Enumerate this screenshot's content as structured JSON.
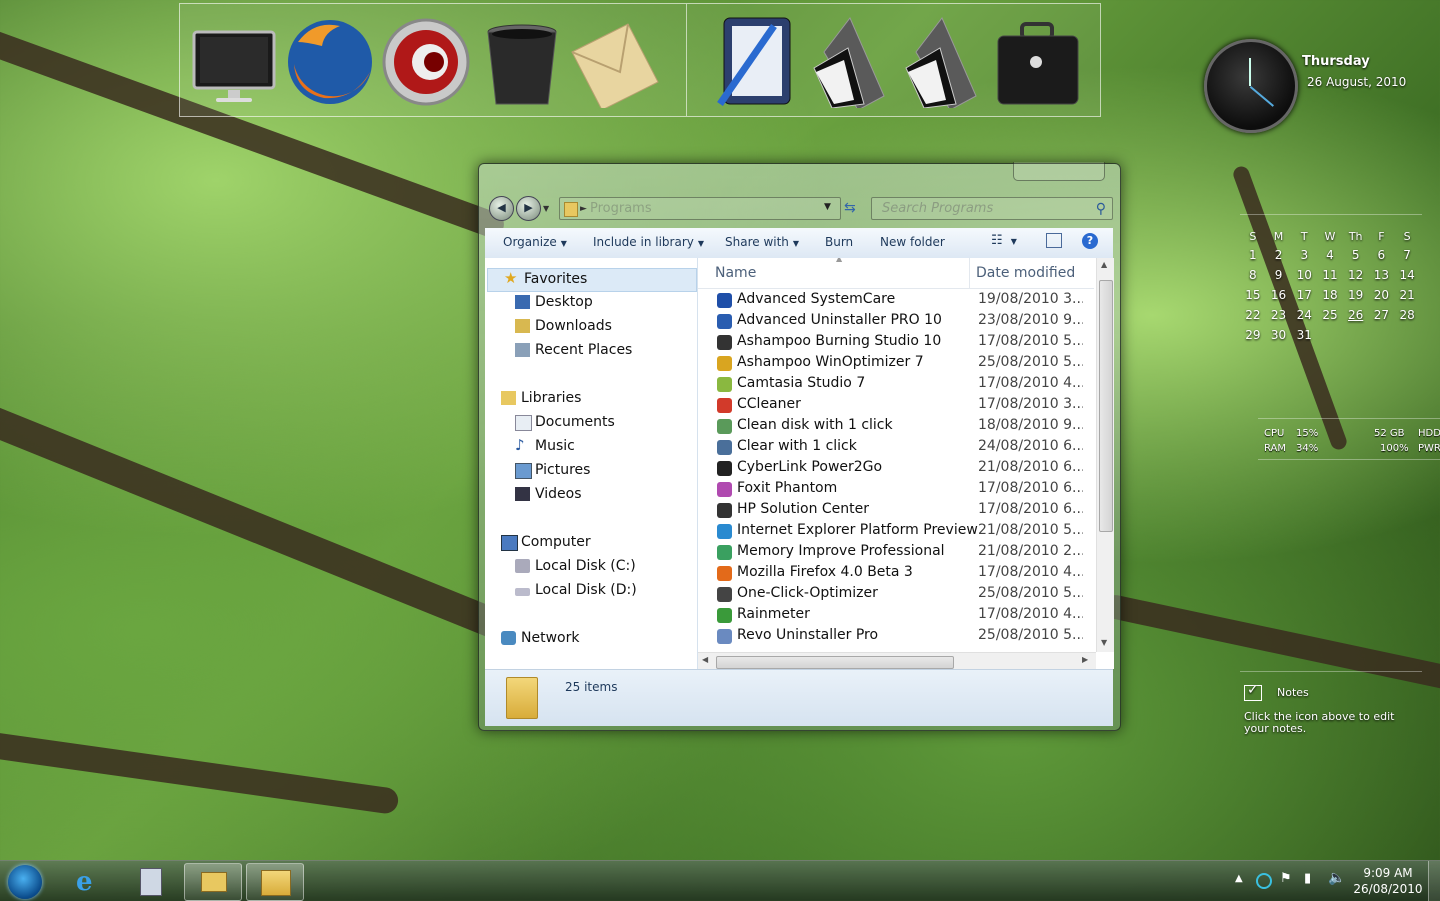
{
  "dock": {
    "items": [
      {
        "name": "computer-monitor"
      },
      {
        "name": "firefox"
      },
      {
        "name": "comodo-dragon"
      },
      {
        "name": "recycle-bin"
      },
      {
        "name": "mail-envelope"
      },
      {
        "name": "notepad-editor"
      },
      {
        "name": "folder-dark-1"
      },
      {
        "name": "folder-dark-2"
      },
      {
        "name": "briefcase"
      }
    ]
  },
  "clock_gadget": {
    "day": "Thursday",
    "date": "26 August, 2010"
  },
  "calendar": {
    "weekdays": [
      "S",
      "M",
      "T",
      "W",
      "Th",
      "F",
      "S"
    ],
    "weeks": [
      [
        "",
        "1",
        "2",
        "3",
        "4",
        "5",
        "6",
        "7"
      ],
      [
        "8",
        "9",
        "10",
        "11",
        "12",
        "13",
        "14"
      ],
      [
        "15",
        "16",
        "17",
        "18",
        "19",
        "20",
        "21"
      ],
      [
        "22",
        "23",
        "24",
        "25",
        "26",
        "27",
        "28"
      ],
      [
        "29",
        "30",
        "31",
        "",
        "",
        "",
        ""
      ]
    ],
    "today": "26"
  },
  "system_meter": {
    "cpu_label": "CPU",
    "cpu_value": "15%",
    "ram_label": "RAM",
    "ram_value": "34%",
    "hdd_value": "52 GB",
    "pwr_value": "100%",
    "hdd_label": "HDD",
    "pwr_label": "PWR"
  },
  "notes_gadget": {
    "title": "Notes",
    "hint": "Click the icon above to edit your notes."
  },
  "explorer": {
    "address": "Programs",
    "search_placeholder": "Search Programs",
    "toolbar": {
      "organize": "Organize",
      "include_in_library": "Include in library",
      "share_with": "Share with",
      "burn": "Burn",
      "new_folder": "New folder"
    },
    "nav": {
      "favorites": "Favorites",
      "desktop": "Desktop",
      "downloads": "Downloads",
      "recent_places": "Recent Places",
      "libraries": "Libraries",
      "documents": "Documents",
      "music": "Music",
      "pictures": "Pictures",
      "videos": "Videos",
      "computer": "Computer",
      "local_disk_c": "Local Disk (C:)",
      "local_disk_d": "Local Disk (D:)",
      "network": "Network"
    },
    "columns": {
      "name": "Name",
      "date_modified": "Date modified"
    },
    "files": [
      {
        "name": "Advanced SystemCare",
        "date": "19/08/2010 3...",
        "icon_color": "#1f4fa8"
      },
      {
        "name": "Advanced Uninstaller PRO 10",
        "date": "23/08/2010 9...",
        "icon_color": "#2a5db0"
      },
      {
        "name": "Ashampoo Burning Studio 10",
        "date": "17/08/2010 5...",
        "icon_color": "#333333"
      },
      {
        "name": "Ashampoo WinOptimizer 7",
        "date": "25/08/2010 5...",
        "icon_color": "#d9a520"
      },
      {
        "name": "Camtasia Studio 7",
        "date": "17/08/2010 4...",
        "icon_color": "#8ab840"
      },
      {
        "name": "CCleaner",
        "date": "17/08/2010 3...",
        "icon_color": "#d23a2a"
      },
      {
        "name": "Clean disk with 1 click",
        "date": "18/08/2010 9...",
        "icon_color": "#5a9a5a"
      },
      {
        "name": "Clear with 1 click",
        "date": "24/08/2010 6...",
        "icon_color": "#4a6f9a"
      },
      {
        "name": "CyberLink Power2Go",
        "date": "21/08/2010 6...",
        "icon_color": "#222222"
      },
      {
        "name": "Foxit Phantom",
        "date": "17/08/2010 6...",
        "icon_color": "#b04ab0"
      },
      {
        "name": "HP Solution Center",
        "date": "17/08/2010 6...",
        "icon_color": "#333333"
      },
      {
        "name": "Internet Explorer Platform Preview",
        "date": "21/08/2010 5...",
        "icon_color": "#2a8ad0"
      },
      {
        "name": "Memory Improve Professional",
        "date": "21/08/2010 2...",
        "icon_color": "#3aa060"
      },
      {
        "name": "Mozilla Firefox 4.0 Beta 3",
        "date": "17/08/2010 4...",
        "icon_color": "#e36a1a"
      },
      {
        "name": "One-Click-Optimizer",
        "date": "25/08/2010 5...",
        "icon_color": "#444444"
      },
      {
        "name": "Rainmeter",
        "date": "17/08/2010 4...",
        "icon_color": "#3a9a3a"
      },
      {
        "name": "Revo Uninstaller Pro",
        "date": "25/08/2010 5...",
        "icon_color": "#6a8ac0"
      }
    ],
    "status": "25 items"
  },
  "taskbar": {
    "items": [
      {
        "name": "start-orb"
      },
      {
        "name": "internet-explorer"
      },
      {
        "name": "calculator"
      },
      {
        "name": "window-switcher"
      },
      {
        "name": "windows-explorer"
      }
    ],
    "time": "9:09 AM",
    "date": "26/08/2010"
  }
}
